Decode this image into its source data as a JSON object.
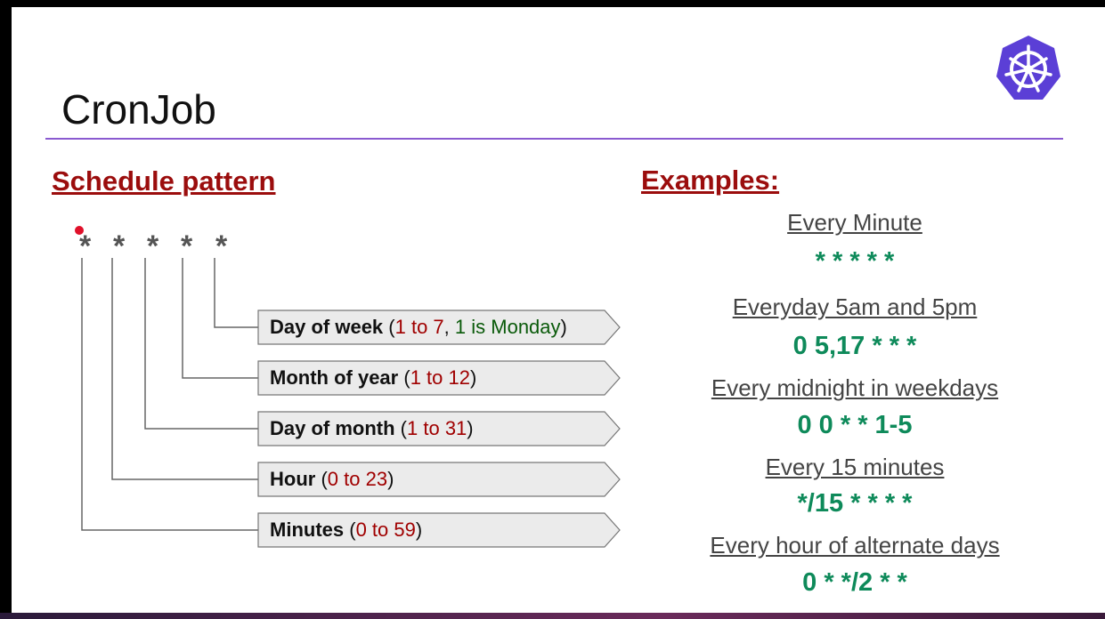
{
  "title": "CronJob",
  "brand_color": "#326ce5",
  "logo_icon": "kubernetes-helm-icon",
  "schedule": {
    "heading": "Schedule pattern",
    "stars": [
      "*",
      "*",
      "*",
      "*",
      "*"
    ],
    "fields": [
      {
        "name": "Day of week",
        "open": " (",
        "range": "1 to 7",
        "sep": ", ",
        "note": "1 is Monday",
        "close": ")"
      },
      {
        "name": "Month of year",
        "open": " (",
        "range": "1 to 12",
        "close": ")"
      },
      {
        "name": "Day of month",
        "open": " (",
        "range": "1 to 31",
        "close": ")"
      },
      {
        "name": "Hour",
        "open": " (",
        "range": "0 to 23",
        "close": ")"
      },
      {
        "name": "Minutes",
        "open": " (",
        "range": "0 to 59",
        "close": ")"
      }
    ]
  },
  "examples": {
    "heading": "Examples:",
    "items": [
      {
        "title": "Every Minute",
        "value": "* * * * *"
      },
      {
        "title": "Everyday 5am and 5pm",
        "value": "0 5,17 * * *"
      },
      {
        "title": "Every midnight in weekdays",
        "value": "0 0 * * 1-5"
      },
      {
        "title": "Every 15 minutes",
        "value": "*/15 * * * *"
      },
      {
        "title": "Every hour of alternate days",
        "value": "0 * */2 * *"
      }
    ]
  }
}
